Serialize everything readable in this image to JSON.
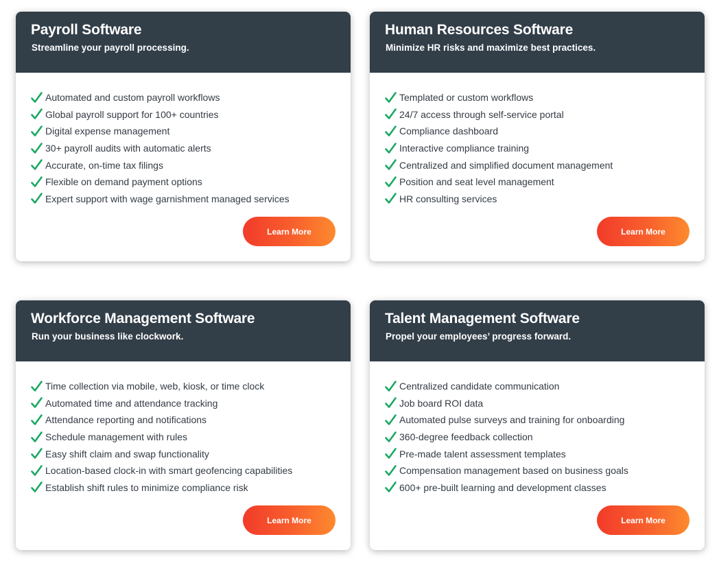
{
  "colors": {
    "header_bg": "#323e48",
    "check_green": "#1aa864",
    "button_gradient_start": "#f23b2a",
    "button_gradient_end": "#fd8a2e",
    "body_text": "#333b44"
  },
  "icons": {
    "check": "check-icon"
  },
  "cards": [
    {
      "title": "Payroll Software",
      "subtitle": "Streamline your payroll processing.",
      "features": [
        "Automated and custom payroll workflows",
        "Global payroll support for 100+ countries",
        "Digital expense management",
        "30+ payroll audits with automatic alerts",
        "Accurate, on-time tax filings",
        "Flexible on demand payment options",
        "Expert support with wage garnishment managed services"
      ],
      "button_label": "Learn More"
    },
    {
      "title": "Human Resources Software",
      "subtitle": "Minimize HR risks and maximize best practices.",
      "features": [
        "Templated or custom workflows",
        "24/7 access through self-service portal",
        "Compliance dashboard",
        "Interactive compliance training",
        "Centralized and simplified document management",
        "Position and seat level management",
        "HR consulting services"
      ],
      "button_label": "Learn More"
    },
    {
      "title": "Workforce Management Software",
      "subtitle": "Run your business like clockwork.",
      "features": [
        "Time collection via mobile, web, kiosk, or time clock",
        "Automated time and attendance tracking",
        "Attendance reporting and notifications",
        "Schedule management with rules",
        "Easy shift claim and swap functionality",
        "Location-based clock-in with smart geofencing capabilities",
        "Establish shift rules to minimize compliance risk"
      ],
      "button_label": "Learn More"
    },
    {
      "title": "Talent Management Software",
      "subtitle": "Propel your employees’ progress forward.",
      "features": [
        "Centralized candidate communication",
        "Job board ROI data",
        "Automated pulse surveys and training for onboarding",
        "360-degree feedback collection",
        "Pre-made talent assessment templates",
        "Compensation management based on business goals",
        "600+ pre-built learning and development classes"
      ],
      "button_label": "Learn More"
    }
  ]
}
